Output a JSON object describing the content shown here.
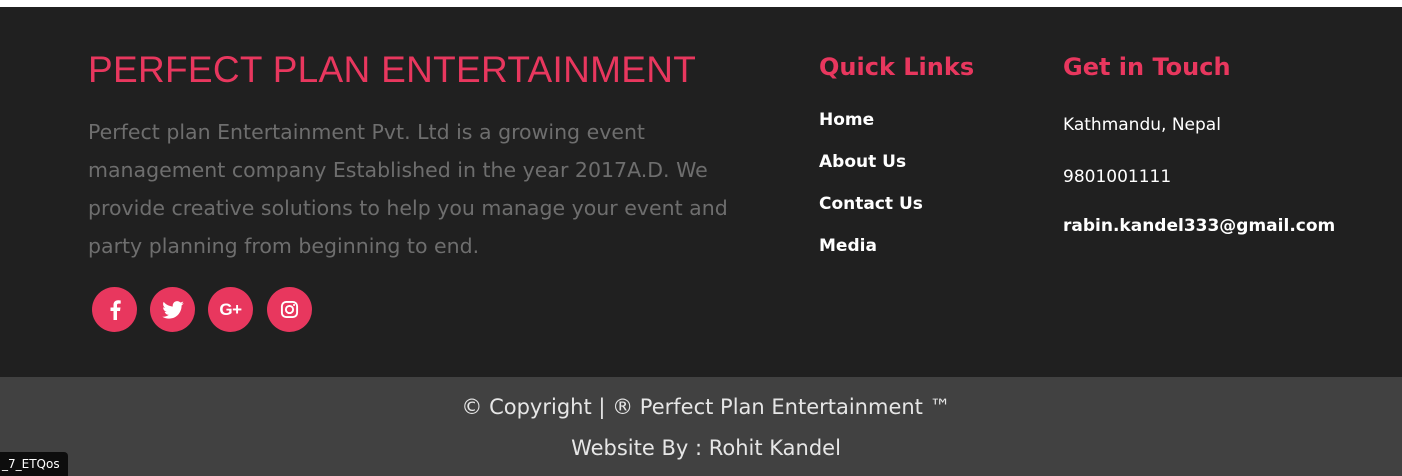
{
  "brand": {
    "title": "PERFECT PLAN ENTERTAINMENT",
    "description": "Perfect plan Entertainment Pvt. Ltd is a growing event management company Established in the year 2017A.D. We provide creative solutions to help you manage your event and party planning from beginning to end."
  },
  "socials": [
    {
      "icon": "facebook-icon"
    },
    {
      "icon": "twitter-icon"
    },
    {
      "icon": "google-plus-icon",
      "glyph": "G+"
    },
    {
      "icon": "instagram-icon"
    }
  ],
  "quick_links": {
    "heading": "Quick Links",
    "items": [
      {
        "label": "Home"
      },
      {
        "label": "About Us"
      },
      {
        "label": "Contact Us"
      },
      {
        "label": "Media"
      }
    ]
  },
  "contact": {
    "heading": "Get in Touch",
    "address": "Kathmandu, Nepal",
    "phone": "9801001111",
    "email": "rabin.kandel333@gmail.com"
  },
  "bottom": {
    "copyright": "© Copyright | ® Perfect Plan Entertainment ™",
    "credit": "Website By : Rohit Kandel"
  },
  "tooltip": "_7_ETQos",
  "colors": {
    "accent": "#e8375e",
    "footer_bg": "#202020",
    "bottom_bg": "#414141"
  }
}
